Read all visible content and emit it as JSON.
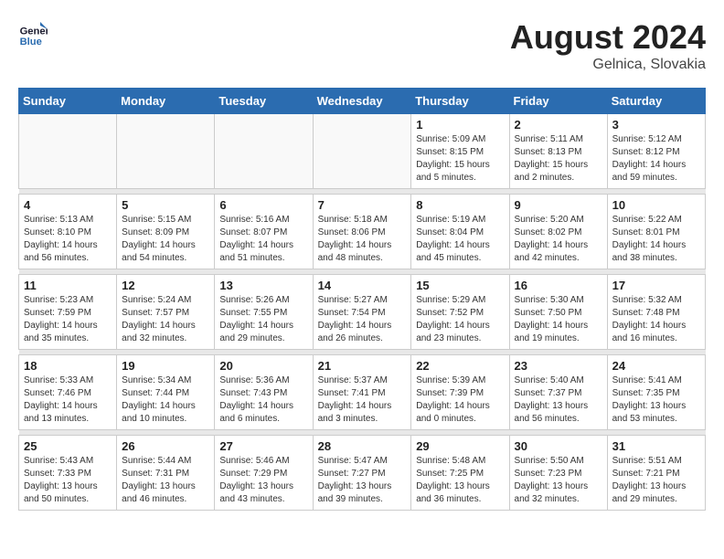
{
  "header": {
    "logo_line1": "General",
    "logo_line2": "Blue",
    "month_year": "August 2024",
    "location": "Gelnica, Slovakia"
  },
  "weekdays": [
    "Sunday",
    "Monday",
    "Tuesday",
    "Wednesday",
    "Thursday",
    "Friday",
    "Saturday"
  ],
  "weeks": [
    [
      {
        "day": "",
        "info": ""
      },
      {
        "day": "",
        "info": ""
      },
      {
        "day": "",
        "info": ""
      },
      {
        "day": "",
        "info": ""
      },
      {
        "day": "1",
        "info": "Sunrise: 5:09 AM\nSunset: 8:15 PM\nDaylight: 15 hours\nand 5 minutes."
      },
      {
        "day": "2",
        "info": "Sunrise: 5:11 AM\nSunset: 8:13 PM\nDaylight: 15 hours\nand 2 minutes."
      },
      {
        "day": "3",
        "info": "Sunrise: 5:12 AM\nSunset: 8:12 PM\nDaylight: 14 hours\nand 59 minutes."
      }
    ],
    [
      {
        "day": "4",
        "info": "Sunrise: 5:13 AM\nSunset: 8:10 PM\nDaylight: 14 hours\nand 56 minutes."
      },
      {
        "day": "5",
        "info": "Sunrise: 5:15 AM\nSunset: 8:09 PM\nDaylight: 14 hours\nand 54 minutes."
      },
      {
        "day": "6",
        "info": "Sunrise: 5:16 AM\nSunset: 8:07 PM\nDaylight: 14 hours\nand 51 minutes."
      },
      {
        "day": "7",
        "info": "Sunrise: 5:18 AM\nSunset: 8:06 PM\nDaylight: 14 hours\nand 48 minutes."
      },
      {
        "day": "8",
        "info": "Sunrise: 5:19 AM\nSunset: 8:04 PM\nDaylight: 14 hours\nand 45 minutes."
      },
      {
        "day": "9",
        "info": "Sunrise: 5:20 AM\nSunset: 8:02 PM\nDaylight: 14 hours\nand 42 minutes."
      },
      {
        "day": "10",
        "info": "Sunrise: 5:22 AM\nSunset: 8:01 PM\nDaylight: 14 hours\nand 38 minutes."
      }
    ],
    [
      {
        "day": "11",
        "info": "Sunrise: 5:23 AM\nSunset: 7:59 PM\nDaylight: 14 hours\nand 35 minutes."
      },
      {
        "day": "12",
        "info": "Sunrise: 5:24 AM\nSunset: 7:57 PM\nDaylight: 14 hours\nand 32 minutes."
      },
      {
        "day": "13",
        "info": "Sunrise: 5:26 AM\nSunset: 7:55 PM\nDaylight: 14 hours\nand 29 minutes."
      },
      {
        "day": "14",
        "info": "Sunrise: 5:27 AM\nSunset: 7:54 PM\nDaylight: 14 hours\nand 26 minutes."
      },
      {
        "day": "15",
        "info": "Sunrise: 5:29 AM\nSunset: 7:52 PM\nDaylight: 14 hours\nand 23 minutes."
      },
      {
        "day": "16",
        "info": "Sunrise: 5:30 AM\nSunset: 7:50 PM\nDaylight: 14 hours\nand 19 minutes."
      },
      {
        "day": "17",
        "info": "Sunrise: 5:32 AM\nSunset: 7:48 PM\nDaylight: 14 hours\nand 16 minutes."
      }
    ],
    [
      {
        "day": "18",
        "info": "Sunrise: 5:33 AM\nSunset: 7:46 PM\nDaylight: 14 hours\nand 13 minutes."
      },
      {
        "day": "19",
        "info": "Sunrise: 5:34 AM\nSunset: 7:44 PM\nDaylight: 14 hours\nand 10 minutes."
      },
      {
        "day": "20",
        "info": "Sunrise: 5:36 AM\nSunset: 7:43 PM\nDaylight: 14 hours\nand 6 minutes."
      },
      {
        "day": "21",
        "info": "Sunrise: 5:37 AM\nSunset: 7:41 PM\nDaylight: 14 hours\nand 3 minutes."
      },
      {
        "day": "22",
        "info": "Sunrise: 5:39 AM\nSunset: 7:39 PM\nDaylight: 14 hours\nand 0 minutes."
      },
      {
        "day": "23",
        "info": "Sunrise: 5:40 AM\nSunset: 7:37 PM\nDaylight: 13 hours\nand 56 minutes."
      },
      {
        "day": "24",
        "info": "Sunrise: 5:41 AM\nSunset: 7:35 PM\nDaylight: 13 hours\nand 53 minutes."
      }
    ],
    [
      {
        "day": "25",
        "info": "Sunrise: 5:43 AM\nSunset: 7:33 PM\nDaylight: 13 hours\nand 50 minutes."
      },
      {
        "day": "26",
        "info": "Sunrise: 5:44 AM\nSunset: 7:31 PM\nDaylight: 13 hours\nand 46 minutes."
      },
      {
        "day": "27",
        "info": "Sunrise: 5:46 AM\nSunset: 7:29 PM\nDaylight: 13 hours\nand 43 minutes."
      },
      {
        "day": "28",
        "info": "Sunrise: 5:47 AM\nSunset: 7:27 PM\nDaylight: 13 hours\nand 39 minutes."
      },
      {
        "day": "29",
        "info": "Sunrise: 5:48 AM\nSunset: 7:25 PM\nDaylight: 13 hours\nand 36 minutes."
      },
      {
        "day": "30",
        "info": "Sunrise: 5:50 AM\nSunset: 7:23 PM\nDaylight: 13 hours\nand 32 minutes."
      },
      {
        "day": "31",
        "info": "Sunrise: 5:51 AM\nSunset: 7:21 PM\nDaylight: 13 hours\nand 29 minutes."
      }
    ]
  ]
}
